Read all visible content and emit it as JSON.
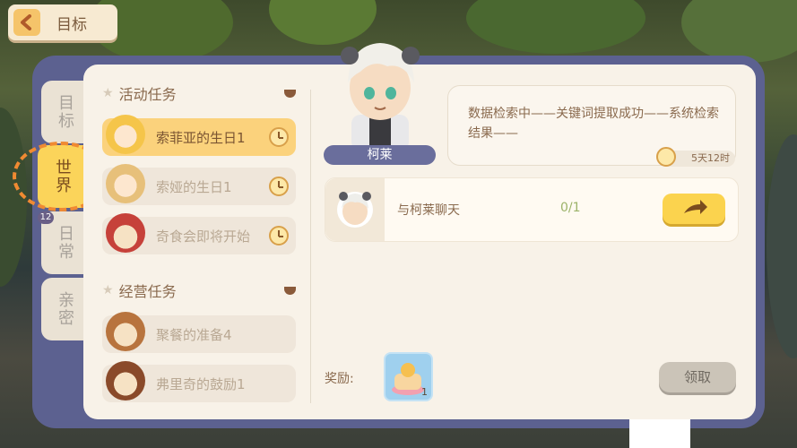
{
  "header": {
    "back_label": "目标"
  },
  "side_tabs": [
    {
      "label": "目标",
      "active": false
    },
    {
      "label": "世界",
      "active": true
    },
    {
      "label": "日常",
      "active": false
    },
    {
      "label": "亲密",
      "active": false
    }
  ],
  "tab_badge_count": "12",
  "sections": {
    "activity": {
      "title": "活动任务",
      "items": [
        "索菲亚的生日1",
        "索娅的生日1",
        "奇食会即将开始"
      ]
    },
    "business": {
      "title": "经营任务",
      "items": [
        "聚餐的准备4",
        "弗里奇的鼓励1"
      ]
    }
  },
  "character": {
    "name": "柯莱"
  },
  "dialog": {
    "text": "数据检索中——关键词提取成功——系统检索结果——",
    "time_left": "5天12时"
  },
  "quest": {
    "label": "与柯莱聊天",
    "progress": "0/1"
  },
  "reward": {
    "label": "奖励:",
    "qty": "1"
  },
  "claim_label": "领取",
  "colors": {
    "accent": "#fbd34e",
    "frame": "#5c6190",
    "panel": "#f8f2e8"
  }
}
